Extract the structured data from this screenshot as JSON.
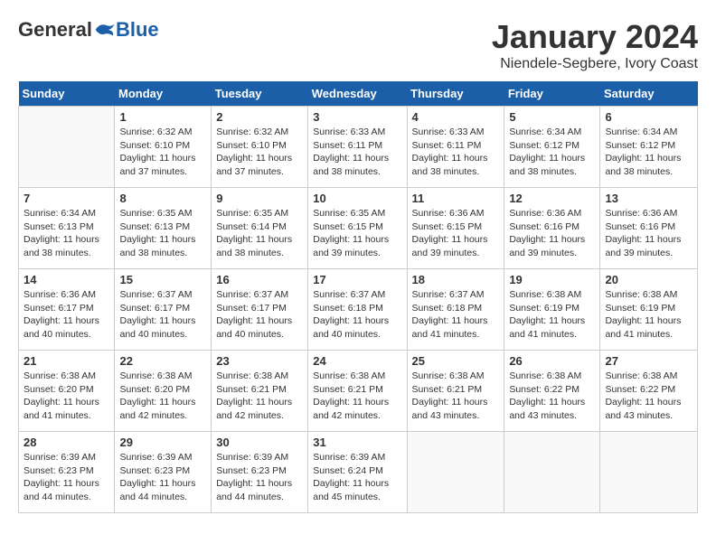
{
  "header": {
    "logo": {
      "general": "General",
      "blue": "Blue"
    },
    "title": "January 2024",
    "location": "Niendele-Segbere, Ivory Coast"
  },
  "calendar": {
    "days_of_week": [
      "Sunday",
      "Monday",
      "Tuesday",
      "Wednesday",
      "Thursday",
      "Friday",
      "Saturday"
    ],
    "weeks": [
      [
        {
          "day": "",
          "info": ""
        },
        {
          "day": "1",
          "info": "Sunrise: 6:32 AM\nSunset: 6:10 PM\nDaylight: 11 hours\nand 37 minutes."
        },
        {
          "day": "2",
          "info": "Sunrise: 6:32 AM\nSunset: 6:10 PM\nDaylight: 11 hours\nand 37 minutes."
        },
        {
          "day": "3",
          "info": "Sunrise: 6:33 AM\nSunset: 6:11 PM\nDaylight: 11 hours\nand 38 minutes."
        },
        {
          "day": "4",
          "info": "Sunrise: 6:33 AM\nSunset: 6:11 PM\nDaylight: 11 hours\nand 38 minutes."
        },
        {
          "day": "5",
          "info": "Sunrise: 6:34 AM\nSunset: 6:12 PM\nDaylight: 11 hours\nand 38 minutes."
        },
        {
          "day": "6",
          "info": "Sunrise: 6:34 AM\nSunset: 6:12 PM\nDaylight: 11 hours\nand 38 minutes."
        }
      ],
      [
        {
          "day": "7",
          "info": "Sunrise: 6:34 AM\nSunset: 6:13 PM\nDaylight: 11 hours\nand 38 minutes."
        },
        {
          "day": "8",
          "info": "Sunrise: 6:35 AM\nSunset: 6:13 PM\nDaylight: 11 hours\nand 38 minutes."
        },
        {
          "day": "9",
          "info": "Sunrise: 6:35 AM\nSunset: 6:14 PM\nDaylight: 11 hours\nand 38 minutes."
        },
        {
          "day": "10",
          "info": "Sunrise: 6:35 AM\nSunset: 6:15 PM\nDaylight: 11 hours\nand 39 minutes."
        },
        {
          "day": "11",
          "info": "Sunrise: 6:36 AM\nSunset: 6:15 PM\nDaylight: 11 hours\nand 39 minutes."
        },
        {
          "day": "12",
          "info": "Sunrise: 6:36 AM\nSunset: 6:16 PM\nDaylight: 11 hours\nand 39 minutes."
        },
        {
          "day": "13",
          "info": "Sunrise: 6:36 AM\nSunset: 6:16 PM\nDaylight: 11 hours\nand 39 minutes."
        }
      ],
      [
        {
          "day": "14",
          "info": "Sunrise: 6:36 AM\nSunset: 6:17 PM\nDaylight: 11 hours\nand 40 minutes."
        },
        {
          "day": "15",
          "info": "Sunrise: 6:37 AM\nSunset: 6:17 PM\nDaylight: 11 hours\nand 40 minutes."
        },
        {
          "day": "16",
          "info": "Sunrise: 6:37 AM\nSunset: 6:17 PM\nDaylight: 11 hours\nand 40 minutes."
        },
        {
          "day": "17",
          "info": "Sunrise: 6:37 AM\nSunset: 6:18 PM\nDaylight: 11 hours\nand 40 minutes."
        },
        {
          "day": "18",
          "info": "Sunrise: 6:37 AM\nSunset: 6:18 PM\nDaylight: 11 hours\nand 41 minutes."
        },
        {
          "day": "19",
          "info": "Sunrise: 6:38 AM\nSunset: 6:19 PM\nDaylight: 11 hours\nand 41 minutes."
        },
        {
          "day": "20",
          "info": "Sunrise: 6:38 AM\nSunset: 6:19 PM\nDaylight: 11 hours\nand 41 minutes."
        }
      ],
      [
        {
          "day": "21",
          "info": "Sunrise: 6:38 AM\nSunset: 6:20 PM\nDaylight: 11 hours\nand 41 minutes."
        },
        {
          "day": "22",
          "info": "Sunrise: 6:38 AM\nSunset: 6:20 PM\nDaylight: 11 hours\nand 42 minutes."
        },
        {
          "day": "23",
          "info": "Sunrise: 6:38 AM\nSunset: 6:21 PM\nDaylight: 11 hours\nand 42 minutes."
        },
        {
          "day": "24",
          "info": "Sunrise: 6:38 AM\nSunset: 6:21 PM\nDaylight: 11 hours\nand 42 minutes."
        },
        {
          "day": "25",
          "info": "Sunrise: 6:38 AM\nSunset: 6:21 PM\nDaylight: 11 hours\nand 43 minutes."
        },
        {
          "day": "26",
          "info": "Sunrise: 6:38 AM\nSunset: 6:22 PM\nDaylight: 11 hours\nand 43 minutes."
        },
        {
          "day": "27",
          "info": "Sunrise: 6:38 AM\nSunset: 6:22 PM\nDaylight: 11 hours\nand 43 minutes."
        }
      ],
      [
        {
          "day": "28",
          "info": "Sunrise: 6:39 AM\nSunset: 6:23 PM\nDaylight: 11 hours\nand 44 minutes."
        },
        {
          "day": "29",
          "info": "Sunrise: 6:39 AM\nSunset: 6:23 PM\nDaylight: 11 hours\nand 44 minutes."
        },
        {
          "day": "30",
          "info": "Sunrise: 6:39 AM\nSunset: 6:23 PM\nDaylight: 11 hours\nand 44 minutes."
        },
        {
          "day": "31",
          "info": "Sunrise: 6:39 AM\nSunset: 6:24 PM\nDaylight: 11 hours\nand 45 minutes."
        },
        {
          "day": "",
          "info": ""
        },
        {
          "day": "",
          "info": ""
        },
        {
          "day": "",
          "info": ""
        }
      ]
    ]
  }
}
